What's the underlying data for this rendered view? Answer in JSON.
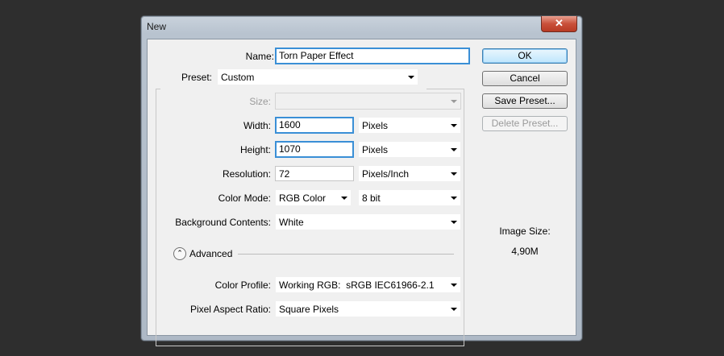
{
  "window": {
    "title": "New",
    "close_glyph": "✕"
  },
  "form": {
    "name_label": "Name:",
    "name_value": "Torn Paper Effect",
    "preset_label": "Preset:",
    "preset_value": "Custom",
    "size_label": "Size:",
    "size_value": "",
    "width_label": "Width:",
    "width_value": "1600",
    "width_unit": "Pixels",
    "height_label": "Height:",
    "height_value": "1070",
    "height_unit": "Pixels",
    "resolution_label": "Resolution:",
    "resolution_value": "72",
    "resolution_unit": "Pixels/Inch",
    "color_mode_label": "Color Mode:",
    "color_mode_value": "RGB Color",
    "bit_depth_value": "8 bit",
    "background_label": "Background Contents:",
    "background_value": "White",
    "advanced_label": "Advanced",
    "advanced_icon": "⌃",
    "color_profile_label": "Color Profile:",
    "color_profile_value": "Working RGB:  sRGB IEC61966-2.1",
    "pixel_aspect_label": "Pixel Aspect Ratio:",
    "pixel_aspect_value": "Square Pixels"
  },
  "buttons": {
    "ok": "OK",
    "cancel": "Cancel",
    "save_preset": "Save Preset...",
    "delete_preset": "Delete Preset..."
  },
  "info": {
    "image_size_label": "Image Size:",
    "image_size_value": "4,90M"
  },
  "colors": {
    "focus_border": "#3a8fd6",
    "close_button": "#c9503a"
  }
}
